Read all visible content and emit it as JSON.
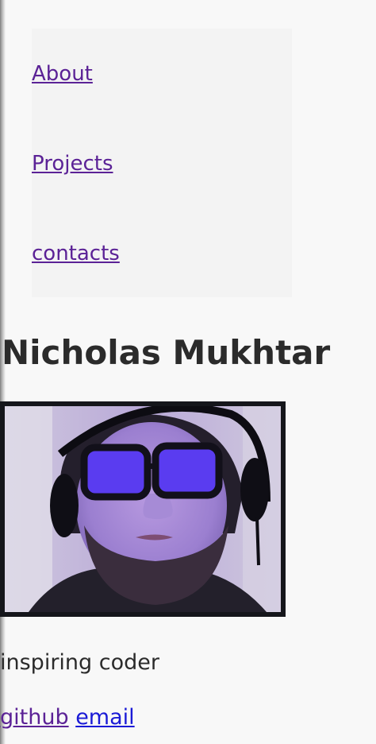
{
  "nav": {
    "items": [
      {
        "label": "About"
      },
      {
        "label": "Projects"
      },
      {
        "label": "contacts"
      }
    ]
  },
  "profile": {
    "name": "Nicholas Mukhtar",
    "tagline": "inspiring coder",
    "links": {
      "github": "github",
      "email": "email"
    }
  },
  "colors": {
    "background": "#f8f8f8",
    "nav_background": "#f3f3f3",
    "visited_link": "#5b2296",
    "link": "#1a1ad6",
    "text": "#2b2b2b",
    "image_border": "#15161b"
  }
}
